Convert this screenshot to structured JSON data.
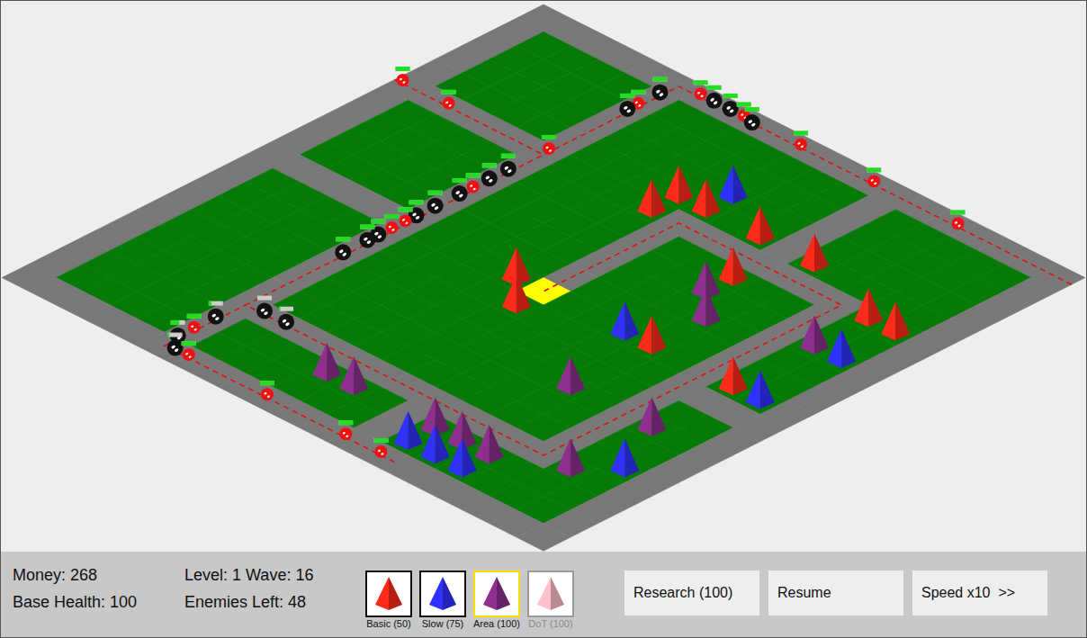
{
  "stats": {
    "left": [
      "Money: 268",
      "Base Health: 100"
    ],
    "right": [
      "Level: 1 Wave: 16",
      "Enemies Left: 48"
    ]
  },
  "tower_types": [
    {
      "kind": "basic",
      "label": "Basic (50)",
      "selected": false,
      "disabled": false,
      "color": "#ff2a1a"
    },
    {
      "kind": "slow",
      "label": "Slow (75)",
      "selected": false,
      "disabled": false,
      "color": "#3030ff"
    },
    {
      "kind": "area",
      "label": "Area (100)",
      "selected": true,
      "disabled": false,
      "color": "#8e2f8e"
    },
    {
      "kind": "dot",
      "label": "DoT (100)",
      "selected": false,
      "disabled": true,
      "color": "#ffc0cb"
    }
  ],
  "actions": [
    "Research (100)",
    "Resume",
    "Speed x10  >>"
  ],
  "map": [
    "....................",
    ".####.#######.#####.",
    ".####.#######.#####.",
    ".####.#######.#####.",
    ".####.#######.#####.",
    "......####.......##.",
    ".####.####.#####.##.",
    ".####.####.#####.##.",
    ".####.####.#####.##.",
    ".####.####.#####.##.",
    "......####B#####.##.",
    ".####.##########....",
    ".####.##########.##.",
    ".####.##########.##.",
    ".####.##########.##.",
    ".####.##########.##.",
    ".####............##.",
    ".####.######.######.",
    ".####.######.######.",
    "...................."
  ],
  "paths": [
    [
      [
        0,
        5.5
      ],
      [
        5.5,
        5.5
      ]
    ],
    [
      [
        20,
        0.5
      ],
      [
        5.5,
        0.5
      ],
      [
        5.5,
        16.5
      ],
      [
        16.5,
        16.5
      ],
      [
        16.5,
        5.5
      ],
      [
        10.5,
        5.5
      ],
      [
        10.5,
        10.5
      ]
    ],
    [
      [
        14,
        19.5
      ],
      [
        5.5,
        19.5
      ],
      [
        5.5,
        16.5
      ]
    ]
  ],
  "towers": [
    {
      "kind": "basic",
      "cell": [
        9,
        5
      ]
    },
    {
      "kind": "basic",
      "cell": [
        9,
        4
      ]
    },
    {
      "kind": "basic",
      "cell": [
        10,
        4
      ]
    },
    {
      "kind": "basic",
      "cell": [
        12,
        4
      ]
    },
    {
      "kind": "basic",
      "cell": [
        14,
        4
      ]
    },
    {
      "kind": "basic",
      "cell": [
        13,
        6
      ]
    },
    {
      "kind": "basic",
      "cell": [
        17,
        5
      ]
    },
    {
      "kind": "basic",
      "cell": [
        18,
        5
      ]
    },
    {
      "kind": "basic",
      "cell": [
        9,
        10
      ]
    },
    {
      "kind": "basic",
      "cell": [
        10,
        11
      ]
    },
    {
      "kind": "basic",
      "cell": [
        14,
        10
      ]
    },
    {
      "kind": "basic",
      "cell": [
        17,
        10
      ]
    },
    {
      "kind": "slow",
      "cell": [
        10,
        3
      ]
    },
    {
      "kind": "slow",
      "cell": [
        13,
        10
      ]
    },
    {
      "kind": "slow",
      "cell": [
        18,
        7
      ]
    },
    {
      "kind": "slow",
      "cell": [
        18,
        10
      ]
    },
    {
      "kind": "slow",
      "cell": [
        13,
        18
      ]
    },
    {
      "kind": "slow",
      "cell": [
        14,
        18
      ]
    },
    {
      "kind": "slow",
      "cell": [
        15,
        18
      ]
    },
    {
      "kind": "slow",
      "cell": [
        18,
        15
      ]
    },
    {
      "kind": "area",
      "cell": [
        13,
        7
      ]
    },
    {
      "kind": "area",
      "cell": [
        14,
        8
      ]
    },
    {
      "kind": "area",
      "cell": [
        17,
        7
      ]
    },
    {
      "kind": "area",
      "cell": [
        14,
        13
      ]
    },
    {
      "kind": "area",
      "cell": [
        17,
        13
      ]
    },
    {
      "kind": "area",
      "cell": [
        9,
        17
      ]
    },
    {
      "kind": "area",
      "cell": [
        10,
        17
      ]
    },
    {
      "kind": "area",
      "cell": [
        13,
        17
      ]
    },
    {
      "kind": "area",
      "cell": [
        14,
        17
      ]
    },
    {
      "kind": "area",
      "cell": [
        15,
        17
      ]
    },
    {
      "kind": "area",
      "cell": [
        17,
        16
      ]
    }
  ],
  "enemies": [
    {
      "kind": "red",
      "at": [
        0.3,
        5.5
      ],
      "health": 1
    },
    {
      "kind": "red",
      "at": [
        2,
        5.5
      ],
      "health": 1
    },
    {
      "kind": "red",
      "at": [
        5.5,
        5.3
      ],
      "health": 1
    },
    {
      "kind": "black",
      "at": [
        5.5,
        2.4
      ],
      "health": 1
    },
    {
      "kind": "red",
      "at": [
        5.5,
        2.0
      ],
      "health": 1
    },
    {
      "kind": "black",
      "at": [
        5.5,
        1.2
      ],
      "health": 1
    },
    {
      "kind": "red",
      "at": [
        6.3,
        0.5
      ],
      "health": 1
    },
    {
      "kind": "black",
      "at": [
        6.8,
        0.5
      ],
      "health": 1
    },
    {
      "kind": "black",
      "at": [
        7.4,
        0.5
      ],
      "health": 1
    },
    {
      "kind": "red",
      "at": [
        7.9,
        0.5
      ],
      "health": 1
    },
    {
      "kind": "black",
      "at": [
        8.3,
        0.6
      ],
      "health": 1
    },
    {
      "kind": "red",
      "at": [
        10,
        0.5
      ],
      "health": 1
    },
    {
      "kind": "red",
      "at": [
        12.7,
        0.5
      ],
      "health": 1
    },
    {
      "kind": "red",
      "at": [
        15.8,
        0.5
      ],
      "health": 1
    },
    {
      "kind": "black",
      "at": [
        5.5,
        6.8
      ],
      "health": 1
    },
    {
      "kind": "black",
      "at": [
        5.5,
        7.5
      ],
      "health": 1
    },
    {
      "kind": "red",
      "at": [
        5.5,
        8.1
      ],
      "health": 1
    },
    {
      "kind": "black",
      "at": [
        5.5,
        8.6
      ],
      "health": 1
    },
    {
      "kind": "black",
      "at": [
        5.5,
        9.5
      ],
      "health": 1
    },
    {
      "kind": "black",
      "at": [
        5.5,
        10.2
      ],
      "health": 1
    },
    {
      "kind": "red",
      "at": [
        5.5,
        10.6
      ],
      "health": 1
    },
    {
      "kind": "red",
      "at": [
        5.5,
        11.1
      ],
      "health": 1
    },
    {
      "kind": "black",
      "at": [
        5.5,
        11.6
      ],
      "health": 1
    },
    {
      "kind": "black",
      "at": [
        5.5,
        12.0
      ],
      "health": 1
    },
    {
      "kind": "black",
      "at": [
        5.5,
        12.9
      ],
      "health": 1
    },
    {
      "kind": "black",
      "at": [
        7.0,
        16.5
      ],
      "health": 0.1
    },
    {
      "kind": "black",
      "at": [
        6.2,
        16.5
      ],
      "health": 0
    },
    {
      "kind": "black",
      "at": [
        5.5,
        17.6
      ],
      "health": 0.2
    },
    {
      "kind": "red",
      "at": [
        5.5,
        18.4
      ],
      "health": 1
    },
    {
      "kind": "black",
      "at": [
        5.5,
        19.0
      ],
      "health": 0.6
    },
    {
      "kind": "black",
      "at": [
        5.9,
        19.5
      ],
      "health": 0.1
    },
    {
      "kind": "red",
      "at": [
        6.4,
        19.5
      ],
      "health": 1
    },
    {
      "kind": "red",
      "at": [
        9.3,
        19.5
      ],
      "health": 1
    },
    {
      "kind": "red",
      "at": [
        12.2,
        19.5
      ],
      "health": 1
    },
    {
      "kind": "red",
      "at": [
        13.5,
        19.5
      ],
      "health": 1
    }
  ]
}
